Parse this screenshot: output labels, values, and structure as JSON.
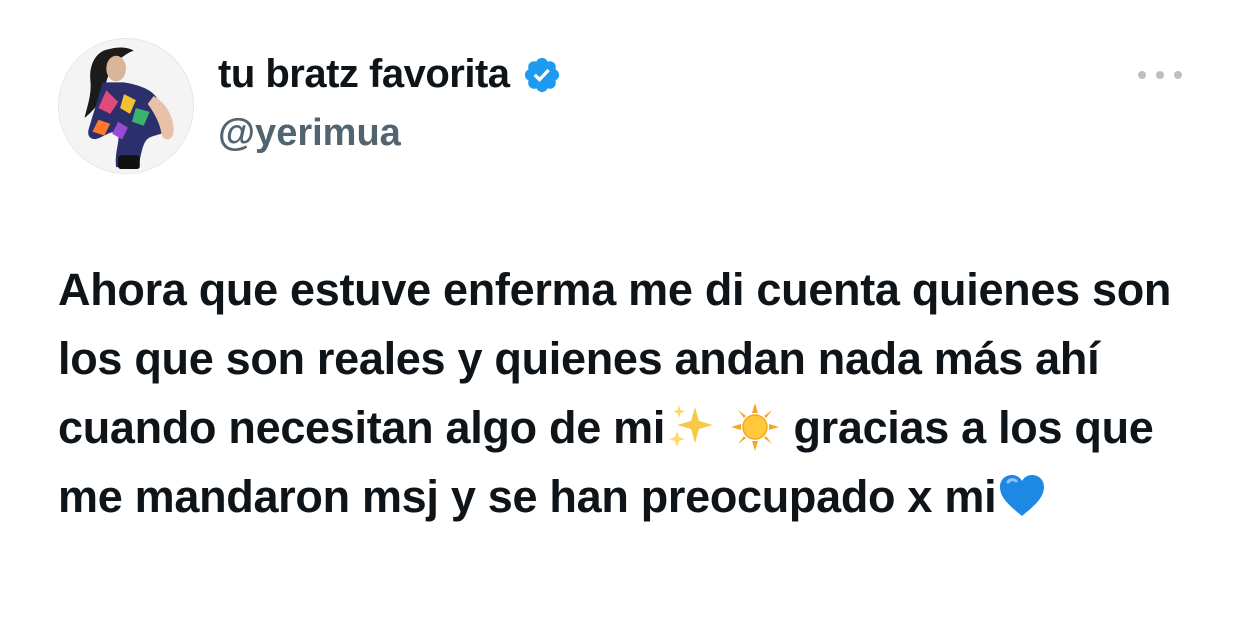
{
  "user": {
    "display_name": "tu bratz favorita",
    "handle": "@yerimua",
    "verified": true
  },
  "tweet": {
    "text_part1": "Ahora que estuve enferma me di cuenta quienes son los que son reales y quienes andan nada más ahí cuando necesitan algo de mi",
    "emoji_1": "sparkles-emoji",
    "emoji_2": "sun-emoji",
    "text_part2": "gracias a los que me mandaron msj y se han preocupado x mi",
    "emoji_3": "blue-heart-emoji"
  },
  "colors": {
    "text": "#0f1419",
    "secondary": "#536471",
    "verified_blue": "#1d9bf0",
    "more_dots": "#b9c0c6"
  }
}
